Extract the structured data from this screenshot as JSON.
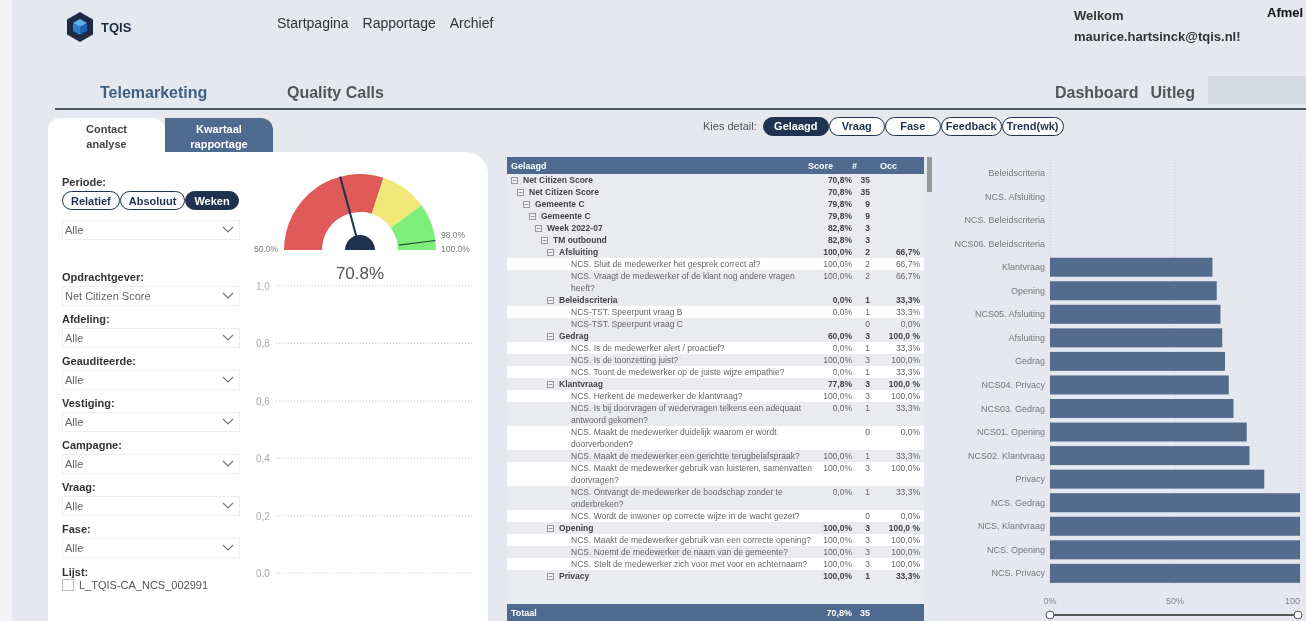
{
  "header": {
    "logo_text": "TQIS",
    "nav": [
      "Startpagina",
      "Rapportage",
      "Archief"
    ],
    "welcome": "Welkom",
    "user": "maurice.hartsinck@tqis.nl!",
    "logout": "Afmel"
  },
  "sections": {
    "tabs": [
      {
        "label": "Telemarketing",
        "selected": true
      },
      {
        "label": "Quality Calls",
        "selected": false
      }
    ],
    "links": [
      "Dashboard",
      "Uitleg"
    ]
  },
  "panel_tabs": [
    {
      "label": "Contact analyse",
      "selected": true
    },
    {
      "label": "Kwartaal rapportage",
      "selected": false
    }
  ],
  "periode": {
    "label": "Periode:",
    "options": [
      {
        "label": "Relatief",
        "selected": false
      },
      {
        "label": "Absoluut",
        "selected": false
      },
      {
        "label": "Weken",
        "selected": true
      }
    ],
    "dropdown": "Alle"
  },
  "filters": [
    {
      "label": "Opdrachtgever:",
      "value": "Net Citizen Score"
    },
    {
      "label": "Afdeling:",
      "value": "Alle"
    },
    {
      "label": "Geauditeerde:",
      "value": "Alle"
    },
    {
      "label": "Vestiging:",
      "value": "Alle"
    },
    {
      "label": "Campagne:",
      "value": "Alle"
    },
    {
      "label": "Vraag:",
      "value": "Alle"
    },
    {
      "label": "Fase:",
      "value": "Alle"
    }
  ],
  "lijst": {
    "label": "Lijst:",
    "item": "L_TQIS-CA_NCS_002991",
    "checked": false
  },
  "gauge": {
    "value": "70.8%",
    "min": "50.0%",
    "max": "100.0%",
    "level": 0.416,
    "target": "98.0%"
  },
  "trend_chart": {
    "axis_labels": [
      "1,0",
      "0,8",
      "0,6",
      "0,4",
      "0,2",
      "0,0"
    ]
  },
  "detail": {
    "label": "Kies detail:",
    "options": [
      {
        "label": "Gelaagd",
        "selected": true
      },
      {
        "label": "Vraag",
        "selected": false
      },
      {
        "label": "Fase",
        "selected": false
      },
      {
        "label": "Feedback",
        "selected": false
      },
      {
        "label": "Trend(wk)",
        "selected": false
      }
    ]
  },
  "table": {
    "columns": [
      "Gelaagd",
      "Score",
      "#",
      "Occ"
    ],
    "rows": [
      {
        "label": "Net Citizen Score",
        "score": "70,8%",
        "count": "35",
        "expanded": true,
        "children": [
          {
            "label": "Net Citizen Score",
            "score": "70,8%",
            "count": "35",
            "expanded": true,
            "children": [
              {
                "label": "Gemeente C",
                "score": "79,8%",
                "count": "9",
                "expanded": true,
                "children": [
                  {
                    "label": "Gemeente C",
                    "score": "79,8%",
                    "count": "9",
                    "expanded": true,
                    "children": [
                      {
                        "label": "Week 2022-07",
                        "score": "82,8%",
                        "count": "3",
                        "expanded": true,
                        "children": [
                          {
                            "label": "TM outbound",
                            "score": "82,8%",
                            "count": "3",
                            "expanded": true,
                            "children": [
                              {
                                "label": "Afsluiting",
                                "score": "100,0%",
                                "count": "2",
                                "occ": "66,7%",
                                "expanded": true,
                                "children": [
                                  {
                                    "label": "NCS. Sluit de medewerker het gesprek correct af?",
                                    "score": "100,0%",
                                    "count": "2",
                                    "occ": "66,7%"
                                  },
                                  {
                                    "label": "NCS. Vraagt de medewerker of de klant nog andere vragen heeft?",
                                    "score": "100,0%",
                                    "count": "2",
                                    "occ": "66,7%"
                                  }
                                ]
                              },
                              {
                                "label": "Beleidscriteria",
                                "score": "0,0%",
                                "count": "1",
                                "occ": "33,3%",
                                "expanded": true,
                                "children": [
                                  {
                                    "label": "NCS-TST. Speerpunt vraag B",
                                    "score": "0,0%",
                                    "count": "1",
                                    "occ": "33,3%"
                                  },
                                  {
                                    "label": "NCS-TST. Speerpunt vraag C",
                                    "count": "0",
                                    "occ": "0,0%"
                                  }
                                ]
                              },
                              {
                                "label": "Gedrag",
                                "score": "60,0%",
                                "count": "3",
                                "occ": "100,0 %",
                                "expanded": true,
                                "children": [
                                  {
                                    "label": "NCS. Is de medewerker alert / proactief?",
                                    "score": "0,0%",
                                    "count": "1",
                                    "occ": "33,3%"
                                  },
                                  {
                                    "label": "NCS. Is de toonzetting juist?",
                                    "score": "100,0%",
                                    "count": "3",
                                    "occ": "100,0%"
                                  },
                                  {
                                    "label": "NCS. Toont de medewerker op de juiste wijze empathie?",
                                    "score": "0,0%",
                                    "count": "1",
                                    "occ": "33,3%"
                                  }
                                ]
                              },
                              {
                                "label": "Klantvraag",
                                "score": "77,8%",
                                "count": "3",
                                "occ": "100,0 %",
                                "expanded": true,
                                "children": [
                                  {
                                    "label": "NCS. Herkent de medewerker de klantvraag?",
                                    "score": "100,0%",
                                    "count": "3",
                                    "occ": "100,0%"
                                  },
                                  {
                                    "label": "NCS. Is bij doorvragen of wedervragen telkens een adequaat antwoord gekomen?",
                                    "score": "0,0%",
                                    "count": "1",
                                    "occ": "33,3%"
                                  },
                                  {
                                    "label": "NCS. Maakt de medewerker duidelijk waarom er wordt doorverbonden?",
                                    "count": "0",
                                    "occ": "0,0%"
                                  },
                                  {
                                    "label": "NCS. Maakt de medewerker een gerichtte terugbelafspraak?",
                                    "score": "100,0%",
                                    "count": "1",
                                    "occ": "33,3%"
                                  },
                                  {
                                    "label": "NCS. Maakt de medewerker gebruik van luisteren, samenvatten doorvragen?",
                                    "score": "100,0%",
                                    "count": "3",
                                    "occ": "100,0%"
                                  },
                                  {
                                    "label": "NCS. Ontvangt de medewerker de boodschap zonder te onderbreken?",
                                    "score": "0,0%",
                                    "count": "1",
                                    "occ": "33,3%"
                                  },
                                  {
                                    "label": "NCS. Wordt de inwoner op correcte wijze in de wacht gezet?",
                                    "count": "0",
                                    "occ": "0,0%"
                                  }
                                ]
                              },
                              {
                                "label": "Opening",
                                "score": "100,0%",
                                "count": "3",
                                "occ": "100,0 %",
                                "expanded": true,
                                "children": [
                                  {
                                    "label": "NCS. Maakt de medewerker gebruik van een correcte opening?",
                                    "score": "100,0%",
                                    "count": "3",
                                    "occ": "100,0%"
                                  },
                                  {
                                    "label": "NCS. Noemt de medewerker de naam van de gemeente?",
                                    "score": "100,0%",
                                    "count": "3",
                                    "occ": "100,0%"
                                  },
                                  {
                                    "label": "NCS. Stelt de medewerker zich voor met voor en achternaam?",
                                    "score": "100,0%",
                                    "count": "3",
                                    "occ": "100,0%"
                                  }
                                ]
                              },
                              {
                                "label": "Privacy",
                                "score": "100,0%",
                                "count": "1",
                                "occ": "33,3%",
                                "expanded": true
                              }
                            ]
                          }
                        ]
                      }
                    ]
                  }
                ]
              }
            ]
          }
        ]
      }
    ],
    "total": {
      "label": "Totaal",
      "score": "70,8%",
      "count": "35"
    }
  },
  "bar_chart": {
    "chart_data": {
      "type": "bar",
      "orientation": "horizontal",
      "categories": [
        "Beleidscriteria",
        "NCS. Afsluiting",
        "NCS. Beleidscriteria",
        "NCS06. Beleidscriteria",
        "Klantvraag",
        "Opening",
        "NCS05. Afsluiting",
        "Afsluiting",
        "Gedrag",
        "NCS04. Privacy",
        "NCS03. Gedrag",
        "NCS01. Opening",
        "NCS02. Klantvraag",
        "Privacy",
        "NCS. Gedrag",
        "NCS. Klantvraag",
        "NCS. Opening",
        "NCS. Privacy"
      ],
      "values": [
        null,
        null,
        null,
        null,
        65,
        66.7,
        68.2,
        68.9,
        70,
        71.5,
        73.4,
        78.7,
        79.8,
        85.7,
        100,
        100,
        100,
        100
      ],
      "xlim": [
        0,
        100
      ],
      "xticks": [
        {
          "value": 0,
          "label": "0%"
        },
        {
          "value": 50,
          "label": "50%"
        },
        {
          "value": 100,
          "label": "100"
        }
      ]
    }
  }
}
